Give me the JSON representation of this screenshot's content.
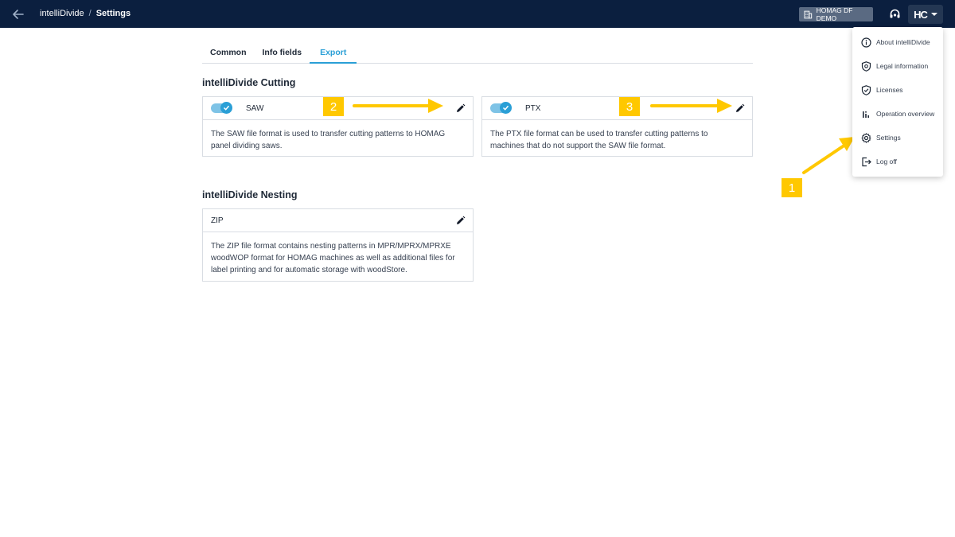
{
  "header": {
    "breadcrumb": [
      "intelliDivide",
      "Settings"
    ],
    "breadcrumb_separator": "/",
    "tenant_label": "HOMAG DF DEMO",
    "user_logo": "HC",
    "colors": {
      "bar": "#0b1f3f",
      "accent": "#2a9fd6",
      "callout": "#ffc800"
    }
  },
  "tabs": [
    {
      "label": "Common",
      "active": false
    },
    {
      "label": "Info fields",
      "active": false
    },
    {
      "label": "Export",
      "active": true
    }
  ],
  "cutting": {
    "title": "intelliDivide Cutting",
    "cards": [
      {
        "name": "SAW",
        "enabled": true,
        "description": "The SAW file format is used to transfer cutting patterns to HOMAG panel dividing saws."
      },
      {
        "name": "PTX",
        "enabled": true,
        "description": "The PTX file format can be used to transfer cutting patterns to machines that do not support the SAW file format."
      }
    ]
  },
  "nesting": {
    "title": "intelliDivide Nesting",
    "cards": [
      {
        "name": "ZIP",
        "description": "The ZIP file format contains nesting patterns in MPR/MPRX/MPRXE woodWOP format for HOMAG machines as well as additional files for label printing and for automatic storage with woodStore."
      }
    ]
  },
  "menu": {
    "items": [
      {
        "label": "About intelliDivide",
        "icon": "info-icon"
      },
      {
        "label": "Legal information",
        "icon": "shield-gear-icon"
      },
      {
        "label": "Licenses",
        "icon": "shield-check-icon"
      },
      {
        "label": "Operation overview",
        "icon": "bar-chart-icon"
      },
      {
        "label": "Settings",
        "icon": "gear-icon"
      },
      {
        "label": "Log off",
        "icon": "logout-icon"
      }
    ]
  },
  "callouts": [
    "1",
    "2",
    "3"
  ]
}
